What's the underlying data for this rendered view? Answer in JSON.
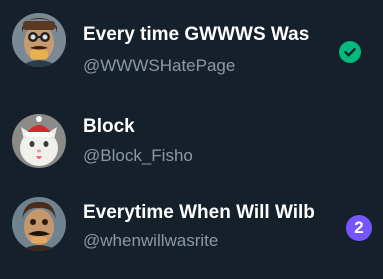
{
  "colors": {
    "background": "#15202b",
    "name_text": "#ffffff",
    "handle_text": "#8b98a5",
    "checkmark_badge": "#00ba7c",
    "count_badge": "#7856ff"
  },
  "accounts": [
    {
      "display_name": "Every time GWWWS Was",
      "handle": "@WWWSHatePage",
      "avatar_icon": "cartoon-face-with-glasses-and-mustache",
      "status_icon": "checkmark-circle-icon"
    },
    {
      "display_name": "Block",
      "handle": "@Block_Fisho",
      "avatar_icon": "white-cat-with-santa-hat"
    },
    {
      "display_name": "Everytime When Will Wilb",
      "handle": "@whenwillwasrite",
      "avatar_icon": "cartoon-face-with-mustache",
      "unread_count": "2"
    }
  ]
}
